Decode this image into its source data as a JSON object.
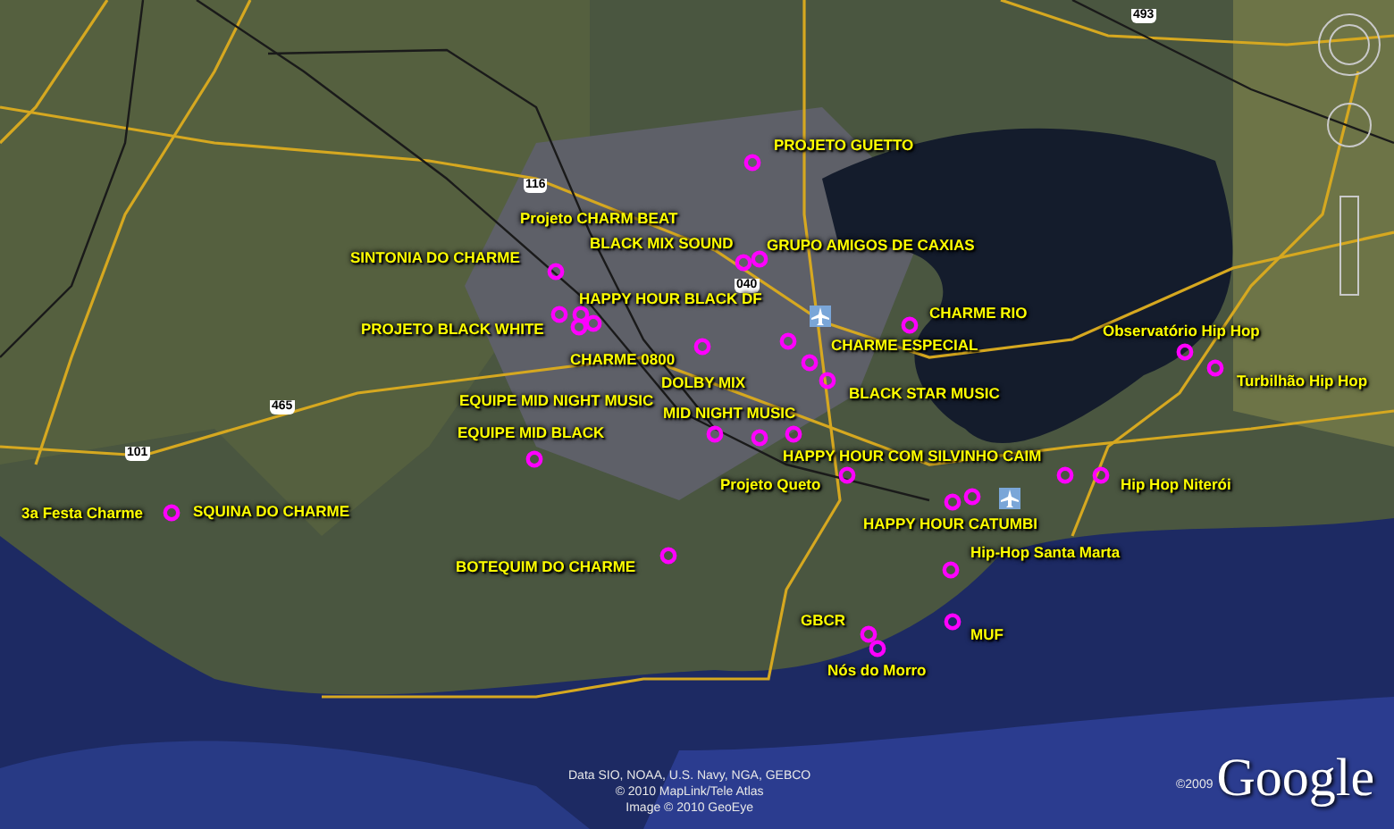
{
  "placemarks": [
    {
      "label": "PROJETO GUETTO"
    },
    {
      "label": "Projeto CHARM BEAT"
    },
    {
      "label": "BLACK MIX SOUND"
    },
    {
      "label": "GRUPO AMIGOS DE CAXIAS"
    },
    {
      "label": "SINTONIA DO CHARME"
    },
    {
      "label": "HAPPY HOUR BLACK DF"
    },
    {
      "label": "CHARME RIO"
    },
    {
      "label": "PROJETO BLACK WHITE"
    },
    {
      "label": "Observatório Hip Hop"
    },
    {
      "label": "CHARME ESPECIAL"
    },
    {
      "label": "CHARME 0800"
    },
    {
      "label": "DOLBY MIX"
    },
    {
      "label": "BLACK STAR MUSIC"
    },
    {
      "label": "Turbilhão Hip Hop"
    },
    {
      "label": "EQUIPE MID NIGHT MUSIC"
    },
    {
      "label": "MID NIGHT MUSIC"
    },
    {
      "label": "EQUIPE MID BLACK"
    },
    {
      "label": "HAPPY HOUR COM SILVINHO CAIM"
    },
    {
      "label": "Projeto Queto"
    },
    {
      "label": "Hip Hop Niterói"
    },
    {
      "label": "3a Festa Charme"
    },
    {
      "label": "SQUINA DO CHARME"
    },
    {
      "label": "HAPPY HOUR CATUMBI"
    },
    {
      "label": "Hip-Hop Santa Marta"
    },
    {
      "label": "BOTEQUIM DO CHARME"
    },
    {
      "label": "GBCR"
    },
    {
      "label": "MUF"
    },
    {
      "label": "Nós do Morro"
    }
  ],
  "road_shields": [
    "116",
    "040",
    "465",
    "101",
    "493"
  ],
  "attribution": [
    "Data SIO, NOAA, U.S. Navy, NGA, GEBCO",
    "© 2010 MapLink/Tele Atlas",
    "Image © 2010 GeoEye"
  ],
  "copyright": "©2009",
  "logo": "Google"
}
